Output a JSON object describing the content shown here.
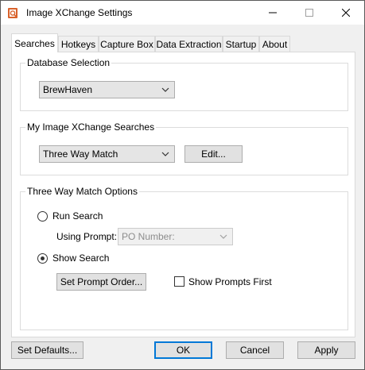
{
  "window": {
    "title": "Image XChange Settings",
    "controls": {
      "minimize": "minimize-icon",
      "maximize": "maximize-icon",
      "close": "close-icon"
    }
  },
  "tabs": [
    {
      "label": "Searches",
      "active": true
    },
    {
      "label": "Hotkeys",
      "active": false
    },
    {
      "label": "Capture Box",
      "active": false
    },
    {
      "label": "Data Extraction",
      "active": false
    },
    {
      "label": "Startup",
      "active": false
    },
    {
      "label": "About",
      "active": false
    }
  ],
  "database_selection": {
    "legend": "Database Selection",
    "selected": "BrewHaven"
  },
  "searches": {
    "legend": "My Image XChange Searches",
    "selected": "Three Way Match",
    "edit_label": "Edit..."
  },
  "options": {
    "legend": "Three Way Match Options",
    "run_search_label": "Run Search",
    "run_search_checked": false,
    "using_prompt_label": "Using Prompt:",
    "prompt_selected": "PO Number:",
    "show_search_label": "Show Search",
    "show_search_checked": true,
    "set_prompt_order_label": "Set Prompt Order...",
    "show_prompts_first_label": "Show Prompts First",
    "show_prompts_first_checked": false
  },
  "footer": {
    "set_defaults_label": "Set Defaults...",
    "ok_label": "OK",
    "cancel_label": "Cancel",
    "apply_label": "Apply"
  },
  "colors": {
    "accent": "#0078d7",
    "window_bg": "#f0f0f0",
    "panel_bg": "#ffffff"
  }
}
